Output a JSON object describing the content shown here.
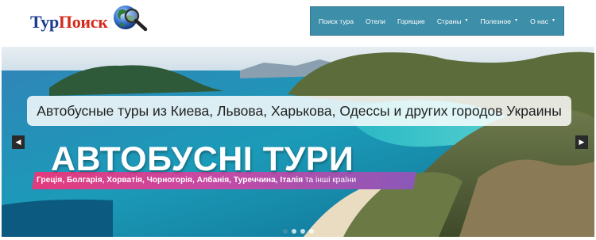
{
  "logo": {
    "part1": "Тур",
    "part2": "Поиск",
    "icon": "globe-magnifier-icon",
    "colors": {
      "part1": "#1a3d8f",
      "part2": "#d42a1c"
    }
  },
  "nav": {
    "items": [
      {
        "label": "Поиск тура",
        "has_dropdown": false
      },
      {
        "label": "Отели",
        "has_dropdown": false
      },
      {
        "label": "Горящие",
        "has_dropdown": false
      },
      {
        "label": "Страны",
        "has_dropdown": true
      },
      {
        "label": "Полезное",
        "has_dropdown": true
      },
      {
        "label": "О нас",
        "has_dropdown": true
      }
    ],
    "background": "#3d8ea8"
  },
  "slider": {
    "caption": "Автобусные туры из Киева, Львова, Харькова, Одессы и других городов Украины",
    "title": "АВТОБУСНІ ТУРИ",
    "countries": "Греція, Болгарія, Хорватія, Чорногорія, Албанія, Туреччина, Італія",
    "countries_tail": "та інші країни",
    "prev_icon": "chevron-left-icon",
    "next_icon": "chevron-right-icon",
    "slides_count": 4,
    "active_slide": 1
  }
}
